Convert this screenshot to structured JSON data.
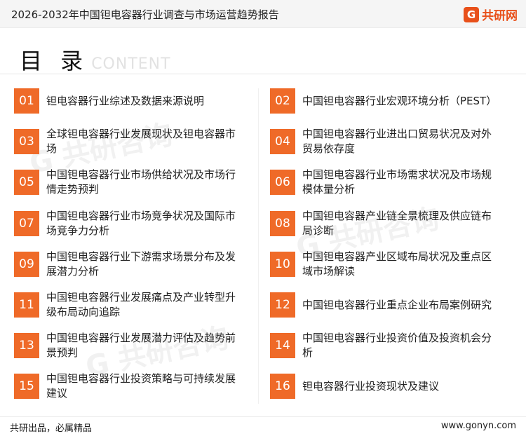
{
  "header": {
    "title": "2026-2032年中国钽电容器行业调查与市场运营趋势报告",
    "brand": {
      "mark": "G",
      "name": "共研网"
    }
  },
  "heading": {
    "cn": "目 录",
    "en": "CONTENT"
  },
  "toc": [
    {
      "num": "01",
      "text": "钽电容器行业综述及数据来源说明"
    },
    {
      "num": "02",
      "text": "中国钽电容器行业宏观环境分析（PEST）"
    },
    {
      "num": "03",
      "text": "全球钽电容器行业发展现状及钽电容器市场"
    },
    {
      "num": "04",
      "text": "中国钽电容器行业进出口贸易状况及对外贸易依存度"
    },
    {
      "num": "05",
      "text": "中国钽电容器行业市场供给状况及市场行情走势预判"
    },
    {
      "num": "06",
      "text": "中国钽电容器行业市场需求状况及市场规模体量分析"
    },
    {
      "num": "07",
      "text": "中国钽电容器行业市场竞争状况及国际市场竞争力分析"
    },
    {
      "num": "08",
      "text": "中国钽电容器产业链全景梳理及供应链布局诊断"
    },
    {
      "num": "09",
      "text": "中国钽电容器行业下游需求场景分布及发展潜力分析"
    },
    {
      "num": "10",
      "text": "中国钽电容器产业区域布局状况及重点区域市场解读"
    },
    {
      "num": "11",
      "text": "中国钽电容器行业发展痛点及产业转型升级布局动向追踪"
    },
    {
      "num": "12",
      "text": "中国钽电容器行业重点企业布局案例研究"
    },
    {
      "num": "13",
      "text": "中国钽电容器行业发展潜力评估及趋势前景预判"
    },
    {
      "num": "14",
      "text": "中国钽电容器行业投资价值及投资机会分析"
    },
    {
      "num": "15",
      "text": "中国钽电容器行业投资策略与可持续发展建议"
    },
    {
      "num": "16",
      "text": "钽电容器行业投资现状及建议"
    }
  ],
  "footer": {
    "left": "共研出品，必属精品",
    "right": "www.gonyn.com"
  },
  "colors": {
    "accent": "#ef6a28",
    "brand": "#e8501a"
  }
}
